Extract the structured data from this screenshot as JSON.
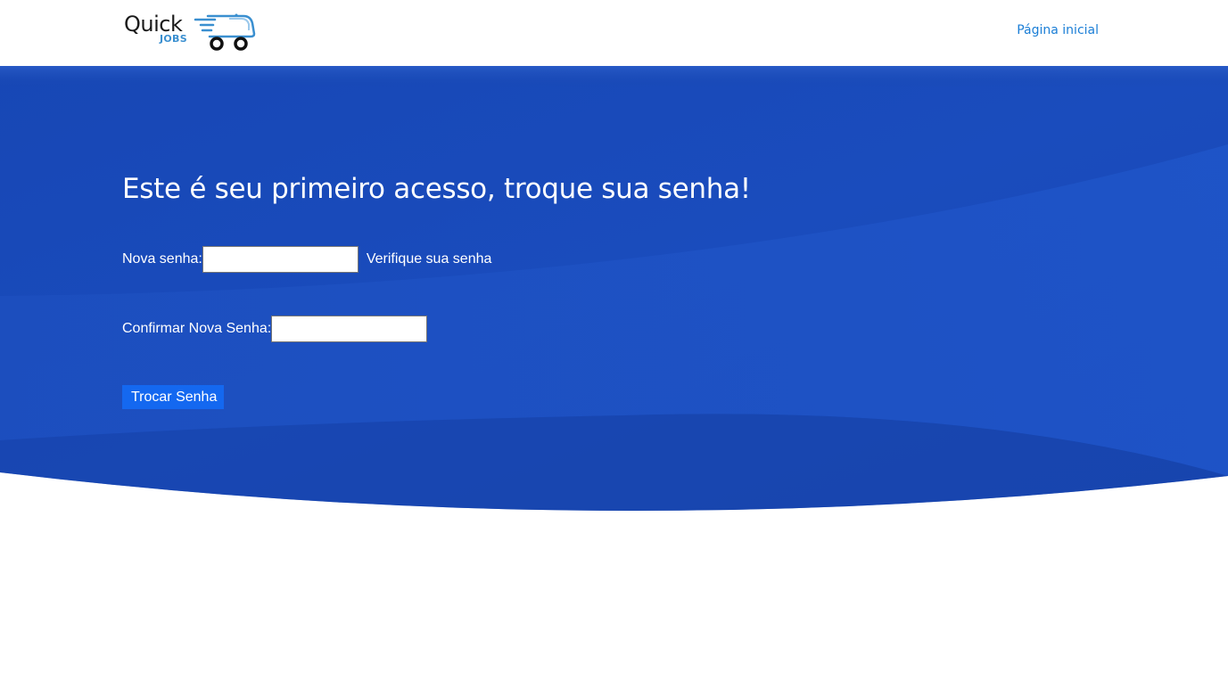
{
  "header": {
    "logo": {
      "word1": "Quick",
      "word2": "JOBS",
      "accent": "#3a8fd0"
    },
    "nav": {
      "home_label": "Página inicial"
    }
  },
  "main": {
    "title": "Este é seu primeiro acesso, troque sua senha!",
    "new_password": {
      "label": "Nova senha:",
      "value": "",
      "placeholder": ""
    },
    "verify_hint": "Verifique sua senha",
    "confirm_password": {
      "label": "Confirmar Nova Senha:",
      "value": "",
      "placeholder": ""
    },
    "submit_label": "Trocar Senha"
  },
  "colors": {
    "hero_blue": "#1646b0",
    "hero_light": "#1f55c6",
    "link_blue": "#1b7ed6",
    "button_blue": "#1468f0"
  }
}
